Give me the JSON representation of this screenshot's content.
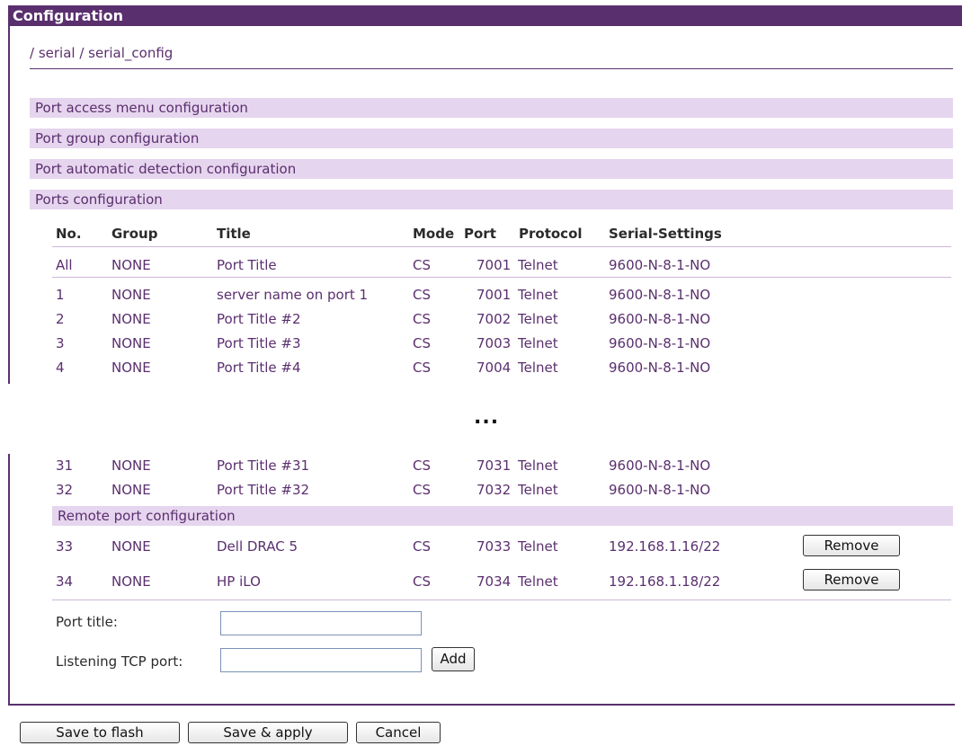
{
  "header": {
    "title": "Configuration"
  },
  "breadcrumb": {
    "sep1": "/ ",
    "item1": "serial",
    "sep2": " / ",
    "item2": "serial_config"
  },
  "sections": {
    "access_menu": "Port access menu configuration",
    "group": "Port group configuration",
    "auto_detect": "Port automatic detection configuration",
    "ports": "Ports configuration",
    "remote": "Remote port configuration"
  },
  "table": {
    "headers": [
      "No.",
      "Group",
      "Title",
      "Mode",
      "Port",
      "Protocol",
      "Serial-Settings"
    ],
    "all_row": {
      "no": "All",
      "group": "NONE",
      "title": "Port Title",
      "mode": "CS",
      "port": "7001",
      "protocol": "Telnet",
      "settings": "9600-N-8-1-NO"
    },
    "rows_top": [
      {
        "no": "1",
        "group": "NONE",
        "title": "server name on port 1",
        "mode": "CS",
        "port": "7001",
        "protocol": "Telnet",
        "settings": "9600-N-8-1-NO"
      },
      {
        "no": "2",
        "group": "NONE",
        "title": "Port Title #2",
        "mode": "CS",
        "port": "7002",
        "protocol": "Telnet",
        "settings": "9600-N-8-1-NO"
      },
      {
        "no": "3",
        "group": "NONE",
        "title": "Port Title #3",
        "mode": "CS",
        "port": "7003",
        "protocol": "Telnet",
        "settings": "9600-N-8-1-NO"
      },
      {
        "no": "4",
        "group": "NONE",
        "title": "Port Title #4",
        "mode": "CS",
        "port": "7004",
        "protocol": "Telnet",
        "settings": "9600-N-8-1-NO"
      }
    ],
    "ellipsis": "...",
    "rows_bottom": [
      {
        "no": "31",
        "group": "NONE",
        "title": "Port Title #31",
        "mode": "CS",
        "port": "7031",
        "protocol": "Telnet",
        "settings": "9600-N-8-1-NO"
      },
      {
        "no": "32",
        "group": "NONE",
        "title": "Port Title #32",
        "mode": "CS",
        "port": "7032",
        "protocol": "Telnet",
        "settings": "9600-N-8-1-NO"
      }
    ],
    "remote_rows": [
      {
        "no": "33",
        "group": "NONE",
        "title": "Dell DRAC 5",
        "mode": "CS",
        "port": "7033",
        "protocol": "Telnet",
        "settings": "192.168.1.16/22",
        "button": "Remove"
      },
      {
        "no": "34",
        "group": "NONE",
        "title": "HP iLO",
        "mode": "CS",
        "port": "7034",
        "protocol": "Telnet",
        "settings": "192.168.1.18/22",
        "button": "Remove"
      }
    ]
  },
  "form": {
    "port_title_label": "Port title:",
    "port_title_value": "",
    "tcp_port_label": "Listening TCP port:",
    "tcp_port_value": "",
    "add_label": "Add"
  },
  "footer": {
    "save_flash": "Save to flash",
    "save_apply": "Save & apply",
    "cancel": "Cancel"
  },
  "colors": {
    "accent": "#5a2f6e",
    "section_bg": "#e6d5ee",
    "text": "#5a2f6e"
  }
}
